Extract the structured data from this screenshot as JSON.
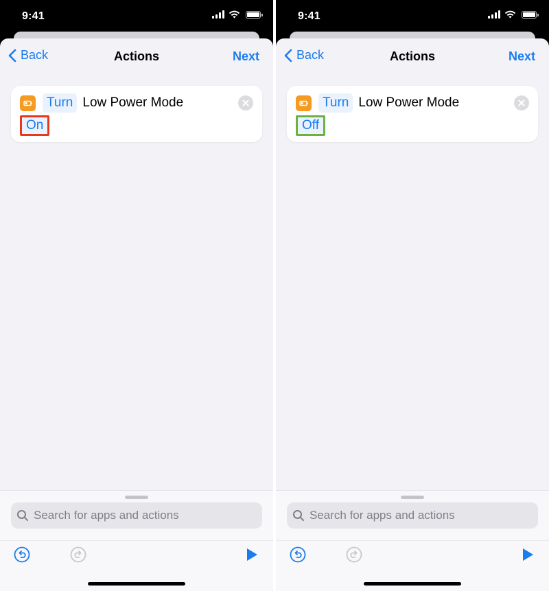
{
  "status_bar": {
    "time": "9:41"
  },
  "nav": {
    "back_label": "Back",
    "title": "Actions",
    "next_label": "Next"
  },
  "screens": [
    {
      "verb": "Turn",
      "action": "Low Power Mode",
      "state": "On",
      "highlight_color": "#e8371a"
    },
    {
      "verb": "Turn",
      "action": "Low Power Mode",
      "state": "Off",
      "highlight_color": "#6bb144"
    }
  ],
  "search": {
    "placeholder": "Search for apps and actions"
  },
  "colors": {
    "accent": "#1a7cf0",
    "app_icon": "#f59a23",
    "sheet_bg": "#f2f2f7"
  },
  "icons": {
    "back": "chevron-left-icon",
    "app": "low-power-battery-icon",
    "remove": "close-icon",
    "search": "magnifier-icon",
    "undo": "undo-icon",
    "redo": "redo-icon",
    "run": "play-icon"
  }
}
